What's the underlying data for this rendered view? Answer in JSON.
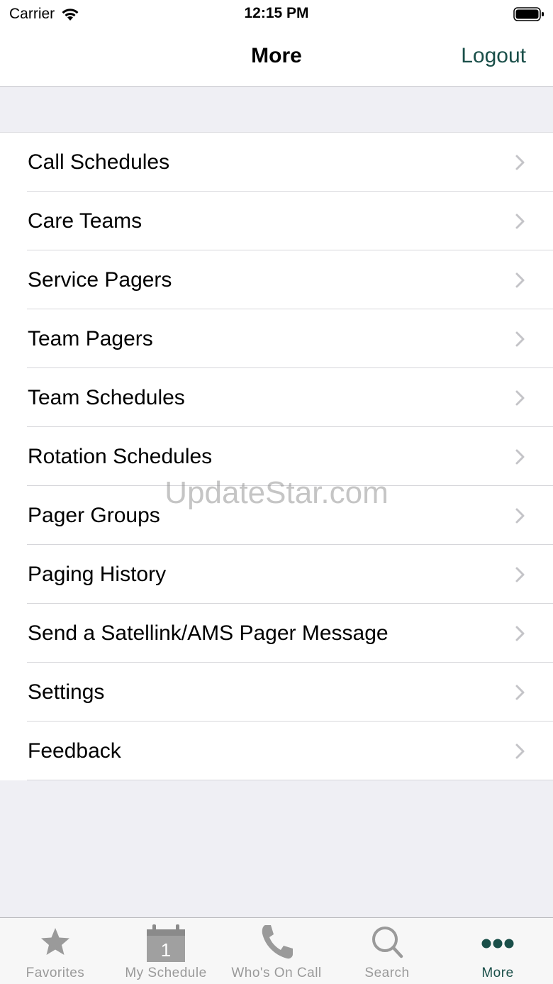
{
  "status_bar": {
    "carrier": "Carrier",
    "time": "12:15 PM"
  },
  "nav": {
    "title": "More",
    "logout_label": "Logout"
  },
  "menu": {
    "items": [
      {
        "label": "Call Schedules"
      },
      {
        "label": "Care Teams"
      },
      {
        "label": "Service Pagers"
      },
      {
        "label": "Team Pagers"
      },
      {
        "label": "Team Schedules"
      },
      {
        "label": "Rotation Schedules"
      },
      {
        "label": "Pager Groups"
      },
      {
        "label": "Paging History"
      },
      {
        "label": "Send a Satellink/AMS Pager Message"
      },
      {
        "label": "Settings"
      },
      {
        "label": "Feedback"
      }
    ]
  },
  "watermark": "UpdateStar.com",
  "tab_bar": {
    "tabs": [
      {
        "label": "Favorites",
        "icon": "star-icon",
        "active": false
      },
      {
        "label": "My Schedule",
        "icon": "calendar-icon",
        "badge": "1",
        "active": false
      },
      {
        "label": "Who's On Call",
        "icon": "phone-icon",
        "active": false
      },
      {
        "label": "Search",
        "icon": "search-icon",
        "active": false
      },
      {
        "label": "More",
        "icon": "more-dots-icon",
        "active": true
      }
    ]
  },
  "colors": {
    "accent": "#1a4f49",
    "inactive": "#9a9a9a",
    "background": "#efeff4"
  }
}
